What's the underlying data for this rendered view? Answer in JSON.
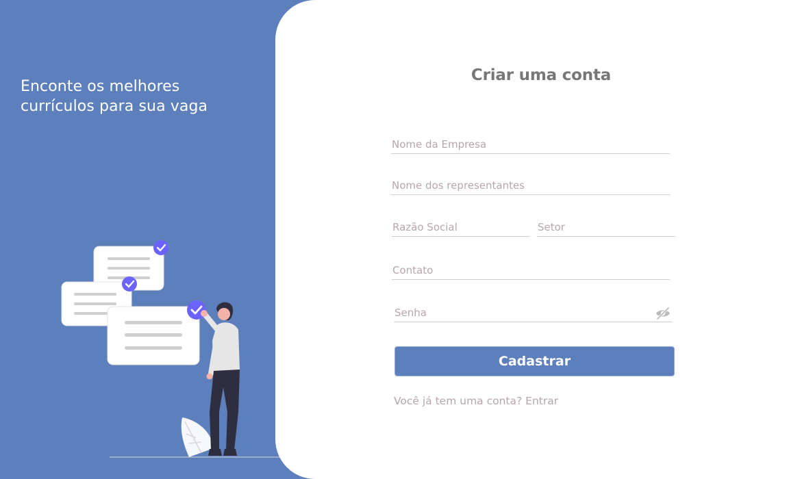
{
  "left": {
    "tagline_line1": "Enconte os melhores",
    "tagline_line2": "currículos para sua vaga"
  },
  "form": {
    "title": "Criar uma conta",
    "fields": {
      "company_name": {
        "placeholder": "Nome da Empresa",
        "value": ""
      },
      "representatives": {
        "placeholder": "Nome dos representantes",
        "value": ""
      },
      "legal_name": {
        "placeholder": "Razão Social",
        "value": ""
      },
      "sector": {
        "placeholder": "Setor",
        "value": ""
      },
      "contact": {
        "placeholder": "Contato",
        "value": ""
      },
      "password": {
        "placeholder": "Senha",
        "value": ""
      }
    },
    "submit_label": "Cadastrar",
    "login_prompt": "Você já tem uma conta? Entrar"
  },
  "icons": {
    "password_toggle": "eye-slash-icon",
    "check": "check-badge-icon"
  },
  "colors": {
    "brand": "#5d7fbb",
    "accent": "#6c63ff",
    "placeholder": "#b8a6ad",
    "title": "#777777"
  }
}
